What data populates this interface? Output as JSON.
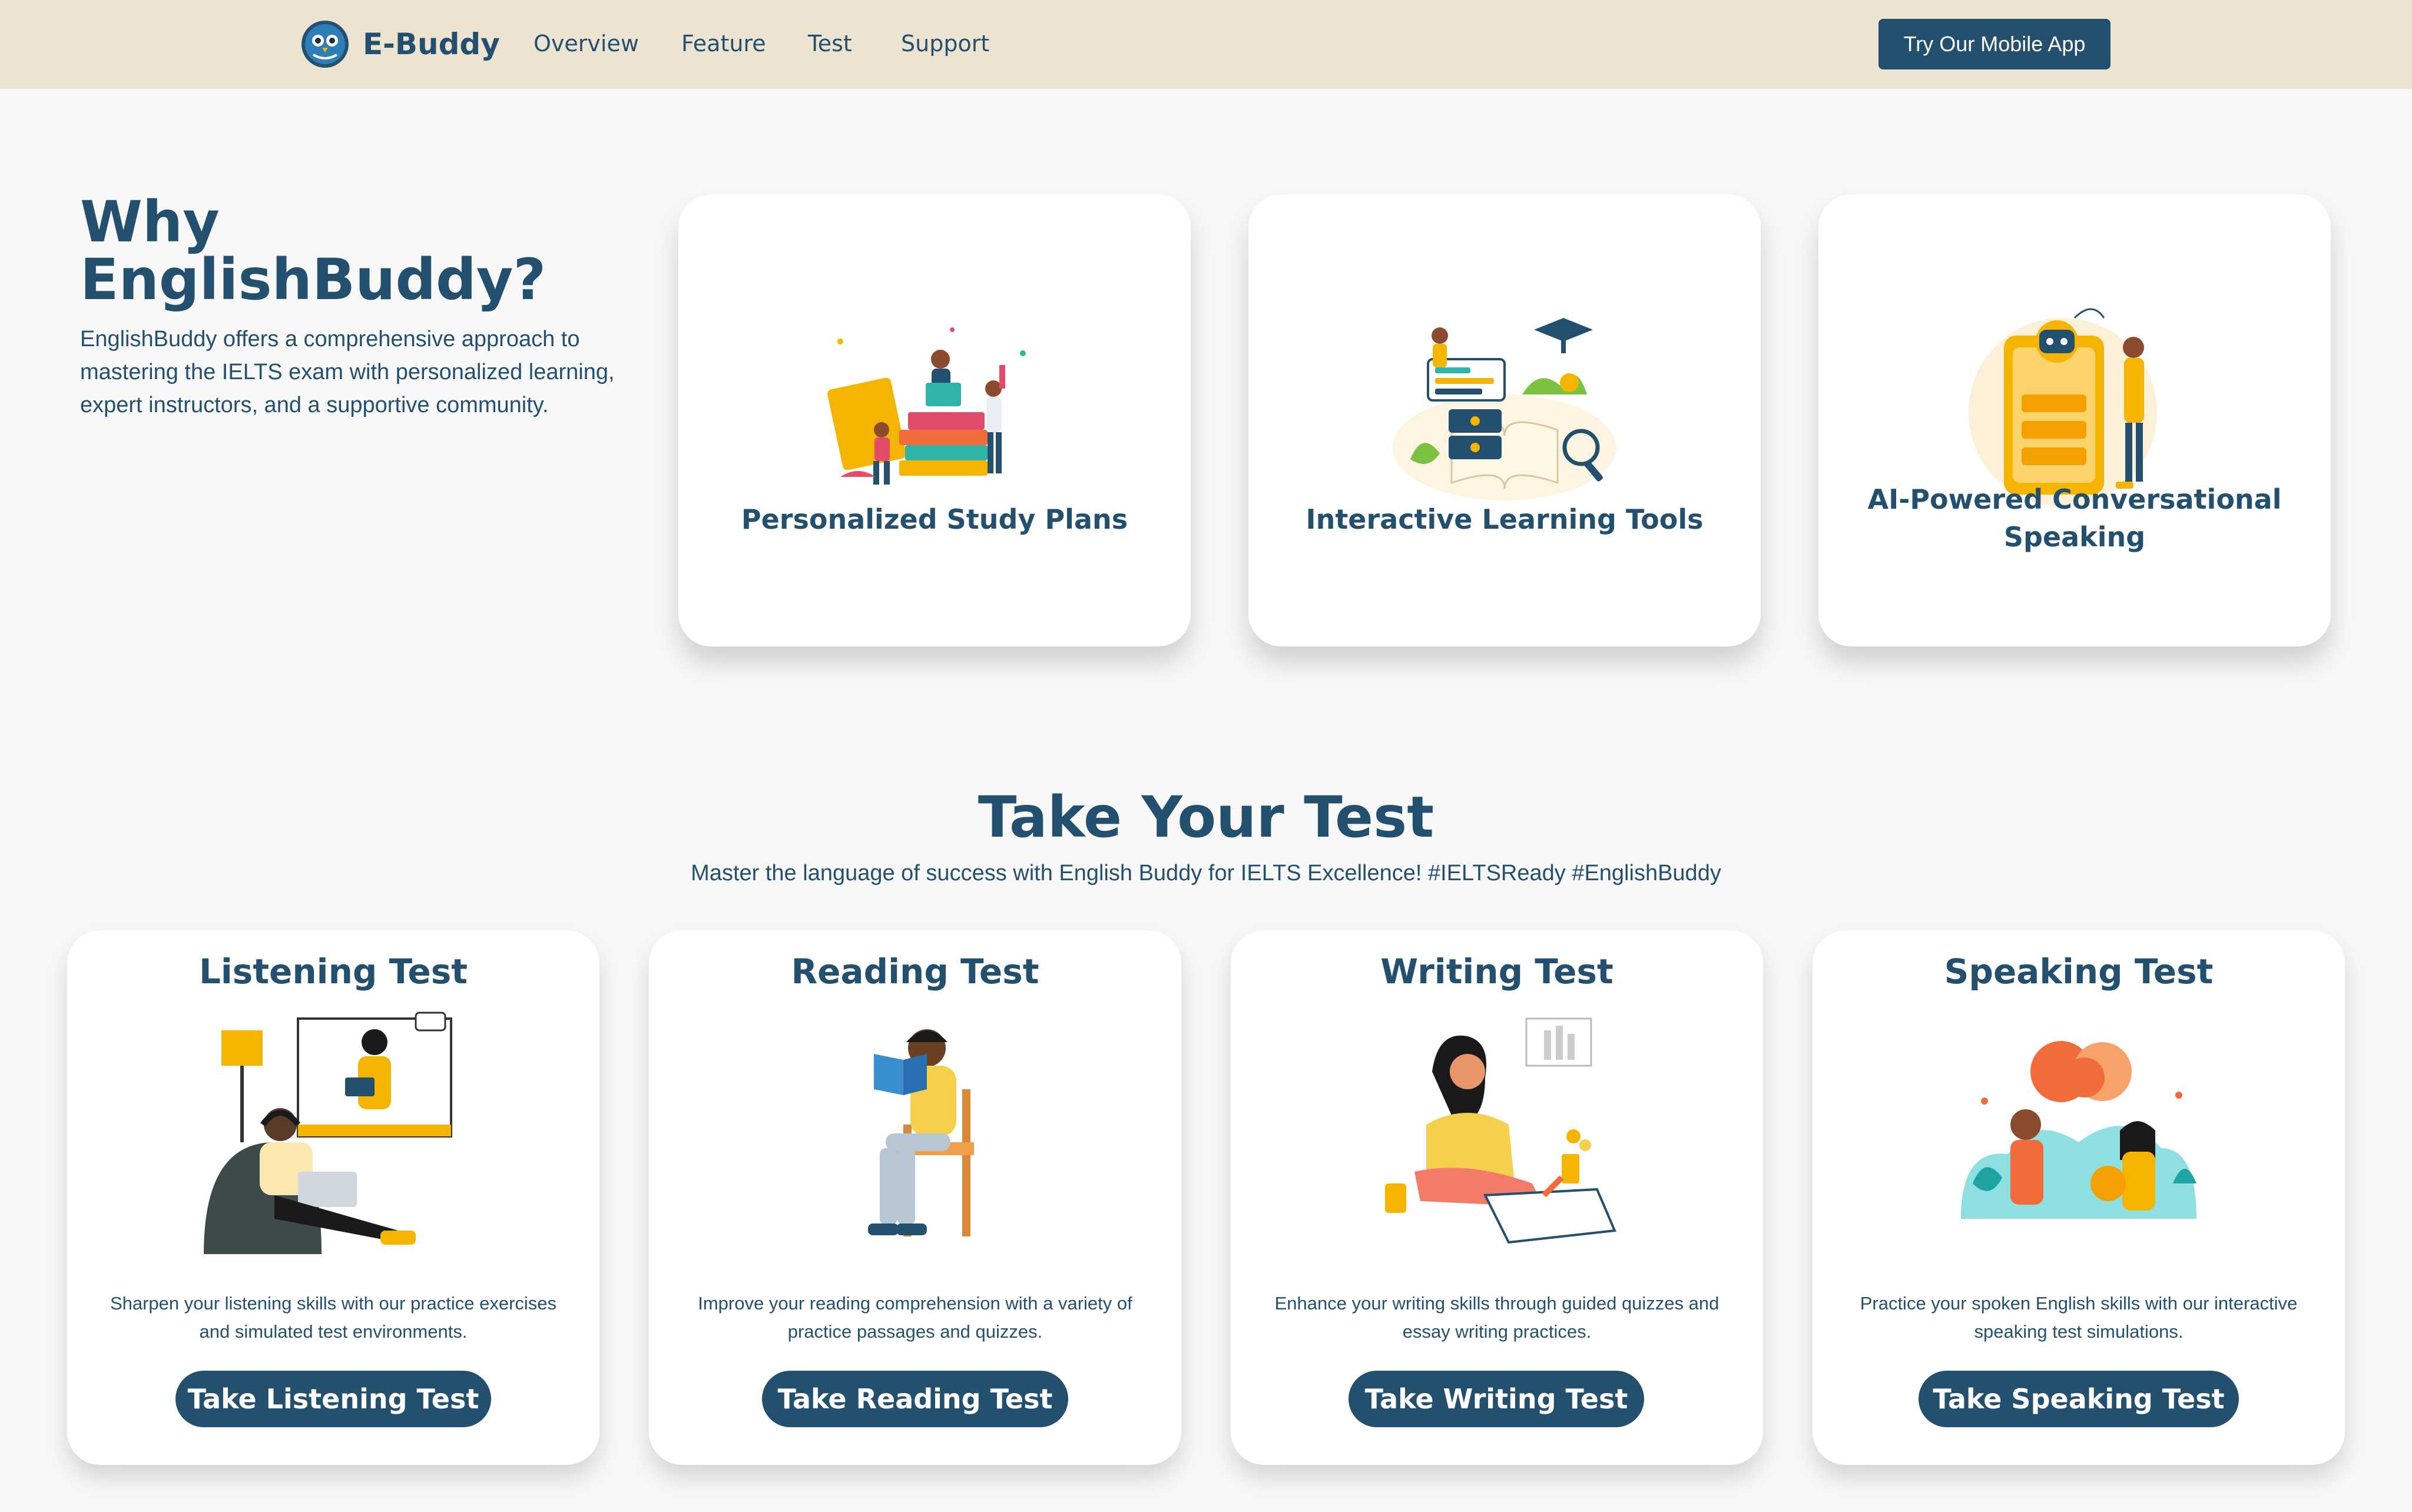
{
  "nav": {
    "brand": "E-Buddy",
    "logo_icon": "owl-logo-icon",
    "links": [
      "Overview",
      "Feature",
      "Test",
      "Support"
    ],
    "cta": "Try Our Mobile App"
  },
  "why": {
    "title_line1": "Why",
    "title_line2": "EnglishBuddy?",
    "description": "EnglishBuddy offers a comprehensive approach to mastering the IELTS exam with personalized learning, expert instructors, and a supportive community."
  },
  "features": [
    {
      "label": "Personalized Study Plans",
      "icon": "students-with-books-illustration"
    },
    {
      "label": "Interactive Learning Tools",
      "icon": "open-book-with-tools-illustration"
    },
    {
      "label": "AI-Powered Conversational Speaking",
      "icon": "robot-chat-phone-illustration"
    }
  ],
  "tests_section": {
    "title": "Take Your Test",
    "subtitle": "Master the language of success with English Buddy for IELTS Excellence! #IELTSReady #EnglishBuddy"
  },
  "tests": [
    {
      "title": "Listening Test",
      "icon": "person-with-headphones-illustration",
      "description": "Sharpen your listening skills with our practice exercises and simulated test environments.",
      "button": "Take Listening Test"
    },
    {
      "title": "Reading Test",
      "icon": "person-reading-book-illustration",
      "description": "Improve your reading comprehension with a variety of practice passages and quizzes.",
      "button": "Take Reading Test"
    },
    {
      "title": "Writing Test",
      "icon": "person-writing-illustration",
      "description": "Enhance your writing skills through guided quizzes and essay writing practices.",
      "button": "Take Writing Test"
    },
    {
      "title": "Speaking Test",
      "icon": "two-people-speaking-illustration",
      "description": "Practice your spoken English skills with our interactive speaking test simulations.",
      "button": "Take Speaking Test"
    }
  ],
  "colors": {
    "primary": "#24506f",
    "nav_bg": "#ece4d0",
    "page_bg": "#f8f8f8",
    "accent_yellow": "#f5b400",
    "accent_orange": "#f26b3a"
  }
}
